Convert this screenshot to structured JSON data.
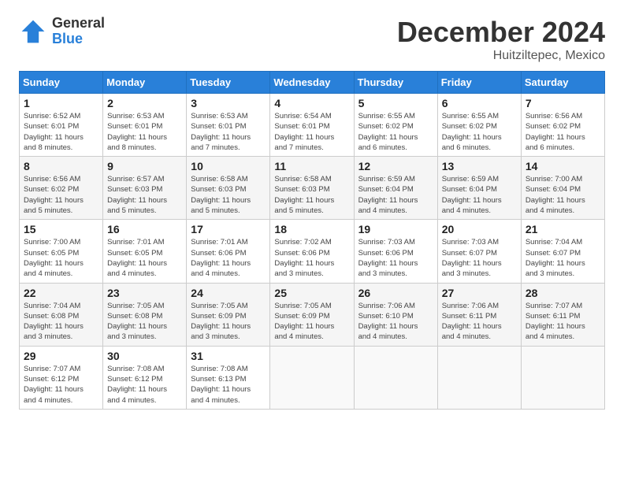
{
  "logo": {
    "general": "General",
    "blue": "Blue"
  },
  "title": "December 2024",
  "location": "Huitziltepec, Mexico",
  "weekdays": [
    "Sunday",
    "Monday",
    "Tuesday",
    "Wednesday",
    "Thursday",
    "Friday",
    "Saturday"
  ],
  "weeks": [
    [
      {
        "day": "1",
        "info": "Sunrise: 6:52 AM\nSunset: 6:01 PM\nDaylight: 11 hours\nand 8 minutes."
      },
      {
        "day": "2",
        "info": "Sunrise: 6:53 AM\nSunset: 6:01 PM\nDaylight: 11 hours\nand 8 minutes."
      },
      {
        "day": "3",
        "info": "Sunrise: 6:53 AM\nSunset: 6:01 PM\nDaylight: 11 hours\nand 7 minutes."
      },
      {
        "day": "4",
        "info": "Sunrise: 6:54 AM\nSunset: 6:01 PM\nDaylight: 11 hours\nand 7 minutes."
      },
      {
        "day": "5",
        "info": "Sunrise: 6:55 AM\nSunset: 6:02 PM\nDaylight: 11 hours\nand 6 minutes."
      },
      {
        "day": "6",
        "info": "Sunrise: 6:55 AM\nSunset: 6:02 PM\nDaylight: 11 hours\nand 6 minutes."
      },
      {
        "day": "7",
        "info": "Sunrise: 6:56 AM\nSunset: 6:02 PM\nDaylight: 11 hours\nand 6 minutes."
      }
    ],
    [
      {
        "day": "8",
        "info": "Sunrise: 6:56 AM\nSunset: 6:02 PM\nDaylight: 11 hours\nand 5 minutes."
      },
      {
        "day": "9",
        "info": "Sunrise: 6:57 AM\nSunset: 6:03 PM\nDaylight: 11 hours\nand 5 minutes."
      },
      {
        "day": "10",
        "info": "Sunrise: 6:58 AM\nSunset: 6:03 PM\nDaylight: 11 hours\nand 5 minutes."
      },
      {
        "day": "11",
        "info": "Sunrise: 6:58 AM\nSunset: 6:03 PM\nDaylight: 11 hours\nand 5 minutes."
      },
      {
        "day": "12",
        "info": "Sunrise: 6:59 AM\nSunset: 6:04 PM\nDaylight: 11 hours\nand 4 minutes."
      },
      {
        "day": "13",
        "info": "Sunrise: 6:59 AM\nSunset: 6:04 PM\nDaylight: 11 hours\nand 4 minutes."
      },
      {
        "day": "14",
        "info": "Sunrise: 7:00 AM\nSunset: 6:04 PM\nDaylight: 11 hours\nand 4 minutes."
      }
    ],
    [
      {
        "day": "15",
        "info": "Sunrise: 7:00 AM\nSunset: 6:05 PM\nDaylight: 11 hours\nand 4 minutes."
      },
      {
        "day": "16",
        "info": "Sunrise: 7:01 AM\nSunset: 6:05 PM\nDaylight: 11 hours\nand 4 minutes."
      },
      {
        "day": "17",
        "info": "Sunrise: 7:01 AM\nSunset: 6:06 PM\nDaylight: 11 hours\nand 4 minutes."
      },
      {
        "day": "18",
        "info": "Sunrise: 7:02 AM\nSunset: 6:06 PM\nDaylight: 11 hours\nand 3 minutes."
      },
      {
        "day": "19",
        "info": "Sunrise: 7:03 AM\nSunset: 6:06 PM\nDaylight: 11 hours\nand 3 minutes."
      },
      {
        "day": "20",
        "info": "Sunrise: 7:03 AM\nSunset: 6:07 PM\nDaylight: 11 hours\nand 3 minutes."
      },
      {
        "day": "21",
        "info": "Sunrise: 7:04 AM\nSunset: 6:07 PM\nDaylight: 11 hours\nand 3 minutes."
      }
    ],
    [
      {
        "day": "22",
        "info": "Sunrise: 7:04 AM\nSunset: 6:08 PM\nDaylight: 11 hours\nand 3 minutes."
      },
      {
        "day": "23",
        "info": "Sunrise: 7:05 AM\nSunset: 6:08 PM\nDaylight: 11 hours\nand 3 minutes."
      },
      {
        "day": "24",
        "info": "Sunrise: 7:05 AM\nSunset: 6:09 PM\nDaylight: 11 hours\nand 3 minutes."
      },
      {
        "day": "25",
        "info": "Sunrise: 7:05 AM\nSunset: 6:09 PM\nDaylight: 11 hours\nand 4 minutes."
      },
      {
        "day": "26",
        "info": "Sunrise: 7:06 AM\nSunset: 6:10 PM\nDaylight: 11 hours\nand 4 minutes."
      },
      {
        "day": "27",
        "info": "Sunrise: 7:06 AM\nSunset: 6:11 PM\nDaylight: 11 hours\nand 4 minutes."
      },
      {
        "day": "28",
        "info": "Sunrise: 7:07 AM\nSunset: 6:11 PM\nDaylight: 11 hours\nand 4 minutes."
      }
    ],
    [
      {
        "day": "29",
        "info": "Sunrise: 7:07 AM\nSunset: 6:12 PM\nDaylight: 11 hours\nand 4 minutes."
      },
      {
        "day": "30",
        "info": "Sunrise: 7:08 AM\nSunset: 6:12 PM\nDaylight: 11 hours\nand 4 minutes."
      },
      {
        "day": "31",
        "info": "Sunrise: 7:08 AM\nSunset: 6:13 PM\nDaylight: 11 hours\nand 4 minutes."
      },
      {
        "day": "",
        "info": ""
      },
      {
        "day": "",
        "info": ""
      },
      {
        "day": "",
        "info": ""
      },
      {
        "day": "",
        "info": ""
      }
    ]
  ]
}
